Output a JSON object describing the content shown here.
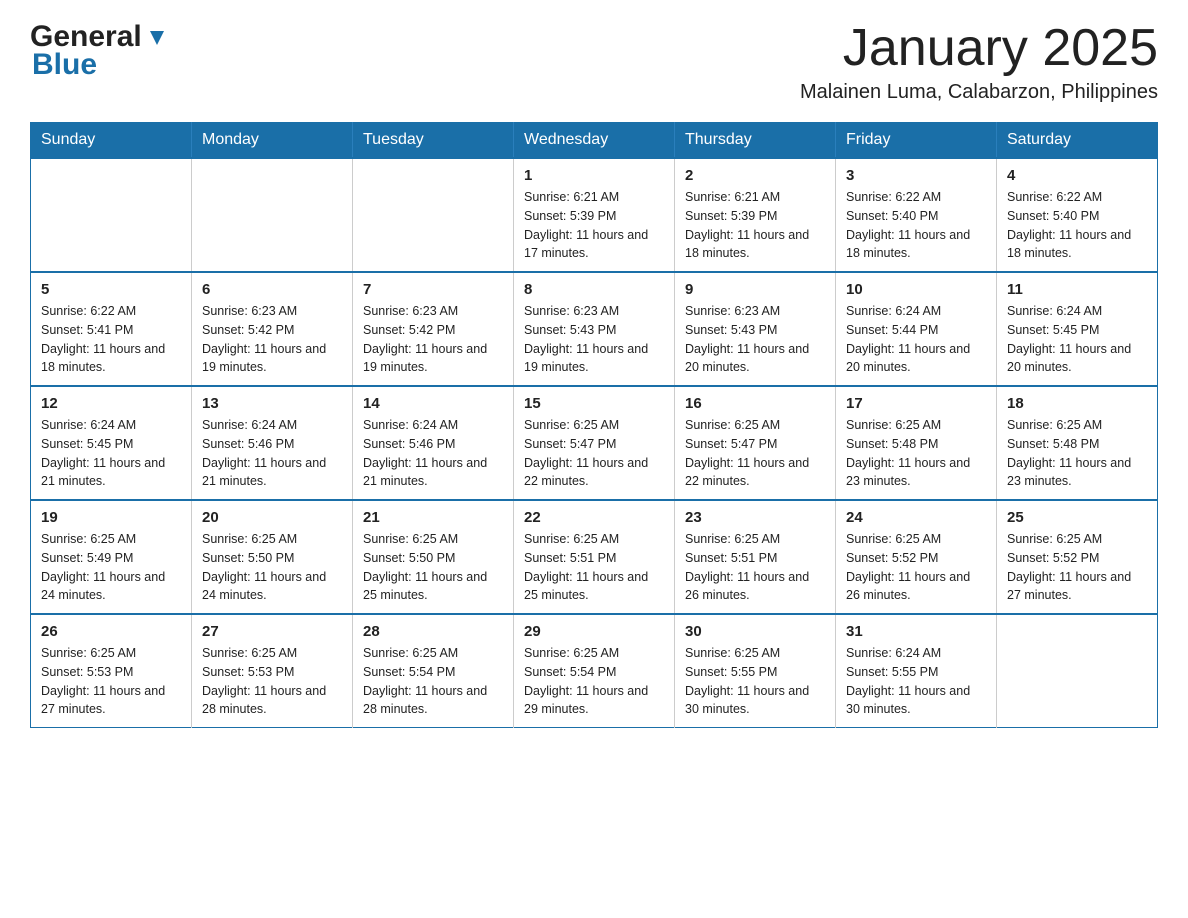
{
  "header": {
    "logo_general": "General",
    "logo_blue": "Blue",
    "month_title": "January 2025",
    "subtitle": "Malainen Luma, Calabarzon, Philippines"
  },
  "days_of_week": [
    "Sunday",
    "Monday",
    "Tuesday",
    "Wednesday",
    "Thursday",
    "Friday",
    "Saturday"
  ],
  "weeks": [
    [
      {
        "day": "",
        "info": ""
      },
      {
        "day": "",
        "info": ""
      },
      {
        "day": "",
        "info": ""
      },
      {
        "day": "1",
        "info": "Sunrise: 6:21 AM\nSunset: 5:39 PM\nDaylight: 11 hours and 17 minutes."
      },
      {
        "day": "2",
        "info": "Sunrise: 6:21 AM\nSunset: 5:39 PM\nDaylight: 11 hours and 18 minutes."
      },
      {
        "day": "3",
        "info": "Sunrise: 6:22 AM\nSunset: 5:40 PM\nDaylight: 11 hours and 18 minutes."
      },
      {
        "day": "4",
        "info": "Sunrise: 6:22 AM\nSunset: 5:40 PM\nDaylight: 11 hours and 18 minutes."
      }
    ],
    [
      {
        "day": "5",
        "info": "Sunrise: 6:22 AM\nSunset: 5:41 PM\nDaylight: 11 hours and 18 minutes."
      },
      {
        "day": "6",
        "info": "Sunrise: 6:23 AM\nSunset: 5:42 PM\nDaylight: 11 hours and 19 minutes."
      },
      {
        "day": "7",
        "info": "Sunrise: 6:23 AM\nSunset: 5:42 PM\nDaylight: 11 hours and 19 minutes."
      },
      {
        "day": "8",
        "info": "Sunrise: 6:23 AM\nSunset: 5:43 PM\nDaylight: 11 hours and 19 minutes."
      },
      {
        "day": "9",
        "info": "Sunrise: 6:23 AM\nSunset: 5:43 PM\nDaylight: 11 hours and 20 minutes."
      },
      {
        "day": "10",
        "info": "Sunrise: 6:24 AM\nSunset: 5:44 PM\nDaylight: 11 hours and 20 minutes."
      },
      {
        "day": "11",
        "info": "Sunrise: 6:24 AM\nSunset: 5:45 PM\nDaylight: 11 hours and 20 minutes."
      }
    ],
    [
      {
        "day": "12",
        "info": "Sunrise: 6:24 AM\nSunset: 5:45 PM\nDaylight: 11 hours and 21 minutes."
      },
      {
        "day": "13",
        "info": "Sunrise: 6:24 AM\nSunset: 5:46 PM\nDaylight: 11 hours and 21 minutes."
      },
      {
        "day": "14",
        "info": "Sunrise: 6:24 AM\nSunset: 5:46 PM\nDaylight: 11 hours and 21 minutes."
      },
      {
        "day": "15",
        "info": "Sunrise: 6:25 AM\nSunset: 5:47 PM\nDaylight: 11 hours and 22 minutes."
      },
      {
        "day": "16",
        "info": "Sunrise: 6:25 AM\nSunset: 5:47 PM\nDaylight: 11 hours and 22 minutes."
      },
      {
        "day": "17",
        "info": "Sunrise: 6:25 AM\nSunset: 5:48 PM\nDaylight: 11 hours and 23 minutes."
      },
      {
        "day": "18",
        "info": "Sunrise: 6:25 AM\nSunset: 5:48 PM\nDaylight: 11 hours and 23 minutes."
      }
    ],
    [
      {
        "day": "19",
        "info": "Sunrise: 6:25 AM\nSunset: 5:49 PM\nDaylight: 11 hours and 24 minutes."
      },
      {
        "day": "20",
        "info": "Sunrise: 6:25 AM\nSunset: 5:50 PM\nDaylight: 11 hours and 24 minutes."
      },
      {
        "day": "21",
        "info": "Sunrise: 6:25 AM\nSunset: 5:50 PM\nDaylight: 11 hours and 25 minutes."
      },
      {
        "day": "22",
        "info": "Sunrise: 6:25 AM\nSunset: 5:51 PM\nDaylight: 11 hours and 25 minutes."
      },
      {
        "day": "23",
        "info": "Sunrise: 6:25 AM\nSunset: 5:51 PM\nDaylight: 11 hours and 26 minutes."
      },
      {
        "day": "24",
        "info": "Sunrise: 6:25 AM\nSunset: 5:52 PM\nDaylight: 11 hours and 26 minutes."
      },
      {
        "day": "25",
        "info": "Sunrise: 6:25 AM\nSunset: 5:52 PM\nDaylight: 11 hours and 27 minutes."
      }
    ],
    [
      {
        "day": "26",
        "info": "Sunrise: 6:25 AM\nSunset: 5:53 PM\nDaylight: 11 hours and 27 minutes."
      },
      {
        "day": "27",
        "info": "Sunrise: 6:25 AM\nSunset: 5:53 PM\nDaylight: 11 hours and 28 minutes."
      },
      {
        "day": "28",
        "info": "Sunrise: 6:25 AM\nSunset: 5:54 PM\nDaylight: 11 hours and 28 minutes."
      },
      {
        "day": "29",
        "info": "Sunrise: 6:25 AM\nSunset: 5:54 PM\nDaylight: 11 hours and 29 minutes."
      },
      {
        "day": "30",
        "info": "Sunrise: 6:25 AM\nSunset: 5:55 PM\nDaylight: 11 hours and 30 minutes."
      },
      {
        "day": "31",
        "info": "Sunrise: 6:24 AM\nSunset: 5:55 PM\nDaylight: 11 hours and 30 minutes."
      },
      {
        "day": "",
        "info": ""
      }
    ]
  ]
}
